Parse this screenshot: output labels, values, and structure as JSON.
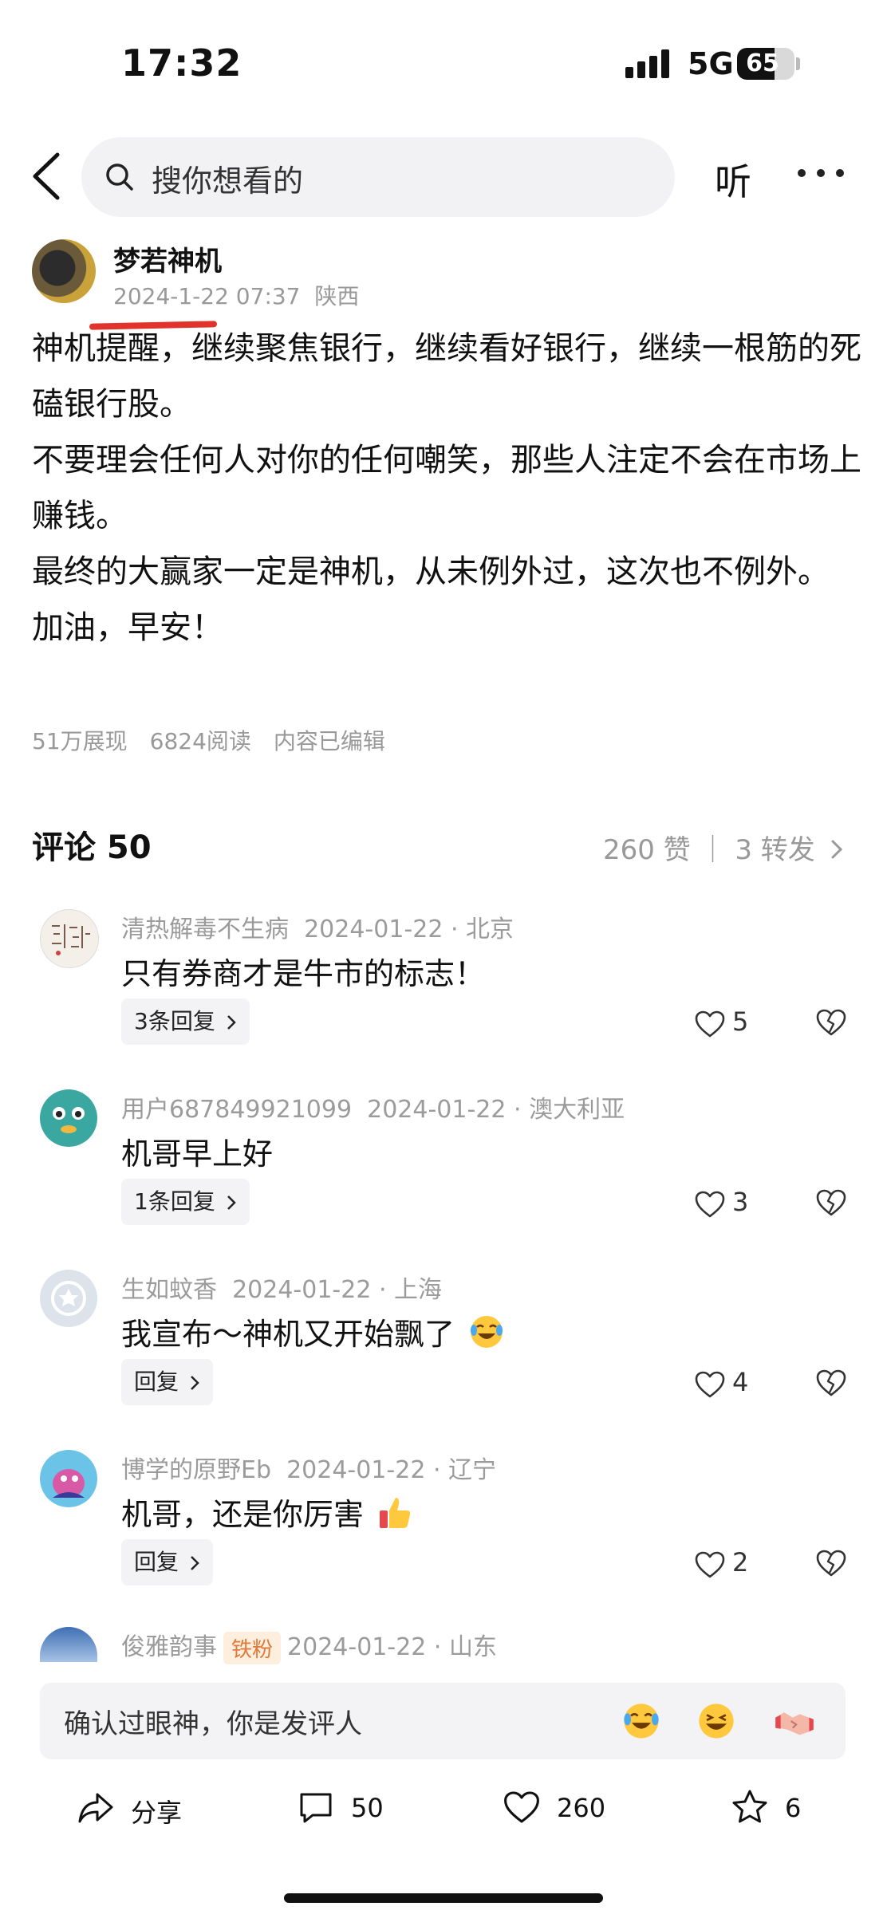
{
  "status_bar": {
    "time": "17:32",
    "network": "5G",
    "battery": "65",
    "battery_level": 0.65
  },
  "top_bar": {
    "search_placeholder": "搜你想看的",
    "listen_label": "听"
  },
  "post": {
    "author": "梦若神机",
    "date": "2024-1-22 07:37",
    "location": "陕西",
    "paragraphs": [
      "神机提醒，继续聚焦银行，继续看好银行，继续一根筋的死磕银行股。",
      "不要理会任何人对你的任何嘲笑，那些人注定不会在市场上赚钱。",
      "最终的大赢家一定是神机，从未例外过，这次也不例外。",
      "加油，早安！"
    ],
    "stats": {
      "impressions": "51万展现",
      "reads": "6824阅读",
      "edited": "内容已编辑"
    }
  },
  "comments_header": {
    "title": "评论 50",
    "summary": "260 赞 ｜ 3 转发"
  },
  "comments": [
    {
      "user": "清热解毒不生病",
      "date": "2024-01-22 · 北京",
      "text": "只有券商才是牛市的标志！",
      "reply": "3条回复",
      "likes": "5"
    },
    {
      "user": "用户687849921099",
      "date": "2024-01-22 · 澳大利亚",
      "text": "机哥早上好",
      "reply": "1条回复",
      "likes": "3"
    },
    {
      "user": "生如蚊香",
      "date": "2024-01-22 · 上海",
      "text": "我宣布～神机又开始飘了",
      "reply": "回复",
      "likes": "4"
    },
    {
      "user": "博学的原野Eb",
      "date": "2024-01-22 · 辽宁",
      "text": "机哥，还是你厉害",
      "reply": "回复",
      "likes": "2"
    },
    {
      "user": "俊雅韵事",
      "badge": "铁粉",
      "date": "2024-01-22 · 山东"
    }
  ],
  "comment_input": {
    "placeholder": "确认过眼神，你是发评人"
  },
  "bottom_actions": {
    "share": "分享",
    "comments": "50",
    "likes": "260",
    "favorites": "6"
  },
  "colors": {
    "accent_red": "#e2322c",
    "muted_text": "#999999",
    "badge_bg": "#fdeede",
    "badge_text": "#e07a3a"
  }
}
